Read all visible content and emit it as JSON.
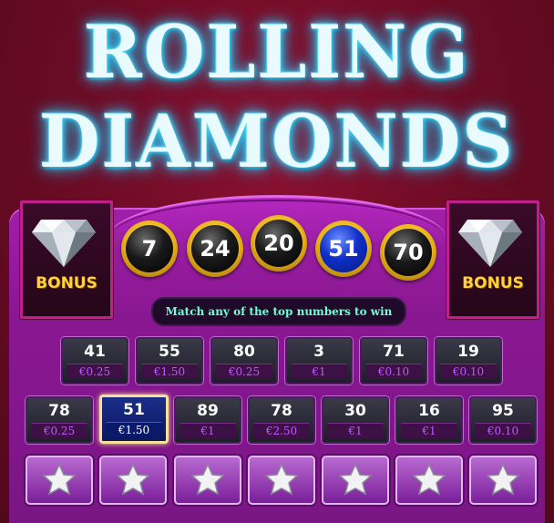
{
  "title": {
    "line1": "ROLLING",
    "line2": "DIAMONDS"
  },
  "bonus": {
    "left_label": "BONUS",
    "right_label": "BONUS"
  },
  "drawn_numbers": [
    {
      "value": "7",
      "highlighted": false
    },
    {
      "value": "24",
      "highlighted": false
    },
    {
      "value": "20",
      "highlighted": false
    },
    {
      "value": "51",
      "highlighted": true
    },
    {
      "value": "70",
      "highlighted": false
    }
  ],
  "message": "Match any of the top numbers to win",
  "row1": [
    {
      "num": "41",
      "amt": "€0.25"
    },
    {
      "num": "55",
      "amt": "€1.50"
    },
    {
      "num": "80",
      "amt": "€0.25"
    },
    {
      "num": "3",
      "amt": "€1"
    },
    {
      "num": "71",
      "amt": "€0.10"
    },
    {
      "num": "19",
      "amt": "€0.10"
    }
  ],
  "row2": [
    {
      "num": "78",
      "amt": "€0.25",
      "matched": false
    },
    {
      "num": "51",
      "amt": "€1.50",
      "matched": true
    },
    {
      "num": "89",
      "amt": "€1",
      "matched": false
    },
    {
      "num": "78",
      "amt": "€2.50",
      "matched": false
    },
    {
      "num": "30",
      "amt": "€1",
      "matched": false
    },
    {
      "num": "16",
      "amt": "€1",
      "matched": false
    },
    {
      "num": "95",
      "amt": "€0.10",
      "matched": false
    }
  ],
  "star_buttons": [
    "star-icon",
    "star-icon",
    "star-icon",
    "star-icon",
    "star-icon",
    "star-icon",
    "star-icon"
  ],
  "colors": {
    "title_glow": "#2cc7f2",
    "bonus_text": "#ffd23c",
    "message_text": "#6fffd6",
    "match_highlight": "#1030c8"
  }
}
